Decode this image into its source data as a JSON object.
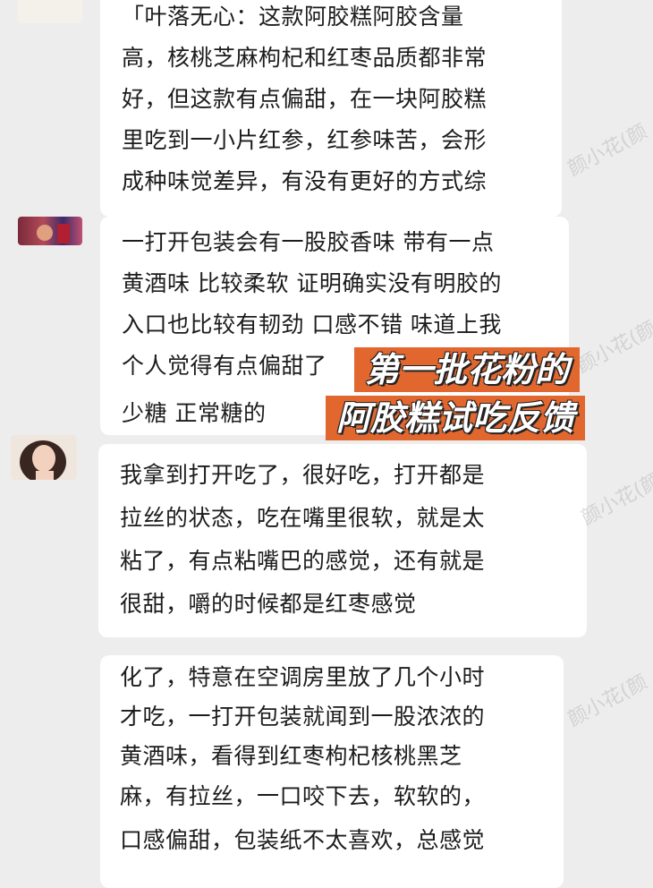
{
  "messages": [
    {
      "lines": [
        "「叶落无心：这款阿胶糕阿胶含量",
        "高，核桃芝麻枸杞和红枣品质都非常",
        "好，但这款有点偏甜，在一块阿胶糕",
        "里吃到一小片红参，红参味苦，会形",
        "成种味觉差异，有没有更好的方式综"
      ]
    },
    {
      "lines": [
        "一打开包装会有一股胶香味 带有一点",
        "黄酒味 比较柔软 证明确实没有明胶的",
        "入口也比较有韧劲 口感不错 味道上我",
        "个人觉得有点偏甜了",
        "少糖 正常糖的"
      ]
    },
    {
      "lines": [
        "我拿到打开吃了，很好吃，打开都是",
        "拉丝的状态，吃在嘴里很软，就是太",
        "粘了，有点粘嘴巴的感觉，还有就是",
        "很甜，嚼的时候都是红枣感觉"
      ]
    },
    {
      "lines": [
        "化了，特意在空调房里放了几个小时",
        "才吃，一打开包装就闻到一股浓浓的",
        "黄酒味，看得到红枣枸杞核桃黑芝",
        "麻，有拉丝，一口咬下去，软软的，",
        "口感偏甜，包装纸不太喜欢，总感觉"
      ]
    }
  ],
  "banner": {
    "line1": "第一批花粉的",
    "line2": "阿胶糕试吃反馈"
  },
  "watermarks": [
    "颜小花(颜",
    "颜小花(颜",
    "颜小花(颜",
    "颜小花(颜"
  ],
  "colors": {
    "banner": "#e2672f",
    "bubble": "#ffffff",
    "background": "#ededed"
  }
}
